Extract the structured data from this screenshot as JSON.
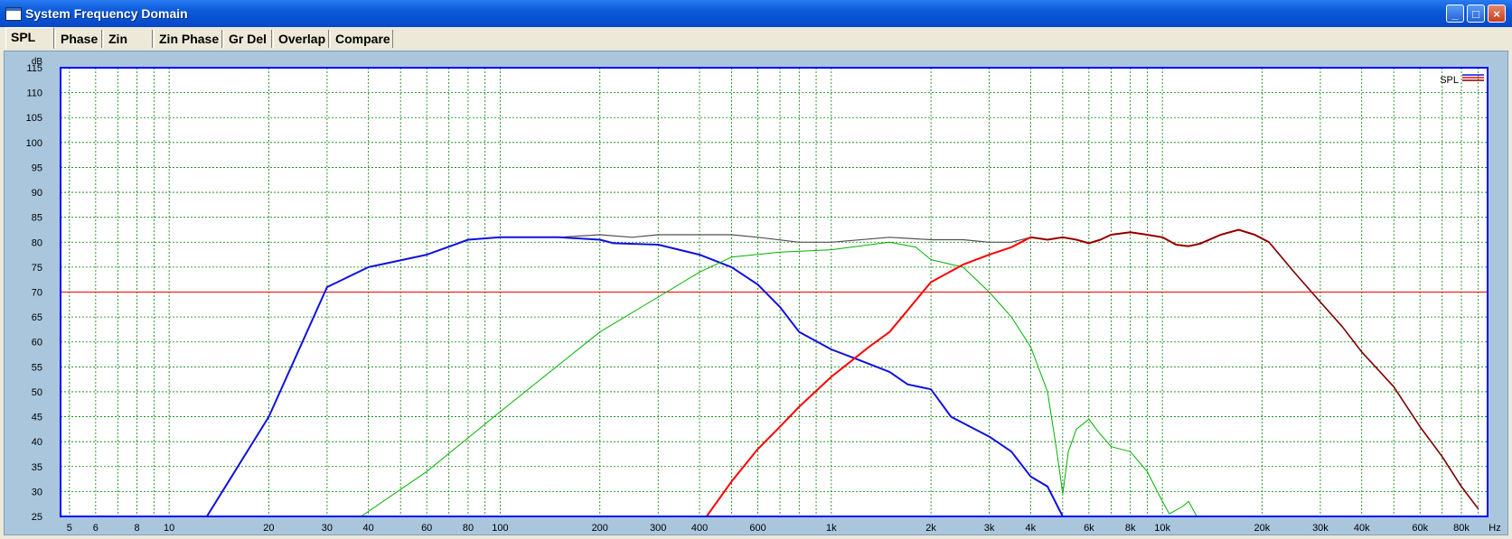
{
  "window": {
    "title": "System Frequency Domain"
  },
  "tabs": [
    {
      "label": "SPL",
      "active": true
    },
    {
      "label": "Phase"
    },
    {
      "label": "Zin"
    },
    {
      "label": "Zin Phase"
    },
    {
      "label": "Gr Del"
    },
    {
      "label": "Overlap"
    },
    {
      "label": "Compare"
    }
  ],
  "chart_data": {
    "type": "line",
    "x_scale": "log",
    "xlim": [
      4.7,
      96000
    ],
    "ylim": [
      25,
      115
    ],
    "ylabel": "dB",
    "xlabel": "Hz",
    "grid": true,
    "legend": {
      "label": "SPL",
      "position": "top-right"
    },
    "y_ticks": [
      25,
      30,
      35,
      40,
      45,
      50,
      55,
      60,
      65,
      70,
      75,
      80,
      85,
      90,
      95,
      100,
      105,
      110,
      115
    ],
    "x_tick_labels": [
      {
        "v": 5,
        "t": "5"
      },
      {
        "v": 6,
        "t": "6"
      },
      {
        "v": 8,
        "t": "8"
      },
      {
        "v": 10,
        "t": "10"
      },
      {
        "v": 20,
        "t": "20"
      },
      {
        "v": 30,
        "t": "30"
      },
      {
        "v": 40,
        "t": "40"
      },
      {
        "v": 60,
        "t": "60"
      },
      {
        "v": 80,
        "t": "80"
      },
      {
        "v": 100,
        "t": "100"
      },
      {
        "v": 200,
        "t": "200"
      },
      {
        "v": 300,
        "t": "300"
      },
      {
        "v": 400,
        "t": "400"
      },
      {
        "v": 600,
        "t": "600"
      },
      {
        "v": 1000,
        "t": "1k"
      },
      {
        "v": 2000,
        "t": "2k"
      },
      {
        "v": 3000,
        "t": "3k"
      },
      {
        "v": 4000,
        "t": "4k"
      },
      {
        "v": 6000,
        "t": "6k"
      },
      {
        "v": 8000,
        "t": "8k"
      },
      {
        "v": 10000,
        "t": "10k"
      },
      {
        "v": 20000,
        "t": "20k"
      },
      {
        "v": 30000,
        "t": "30k"
      },
      {
        "v": 40000,
        "t": "40k"
      },
      {
        "v": 60000,
        "t": "60k"
      },
      {
        "v": 80000,
        "t": "80k"
      }
    ],
    "reference_line": {
      "y": 70,
      "color": "#ff0000"
    },
    "colors": {
      "plot_bg": "#ffffff",
      "grid": "#008000",
      "axis_frame": "#0000ff",
      "outer_bg": "#a9c6dd"
    },
    "series": [
      {
        "color": "#505050",
        "width": 1.2,
        "points": [
          [
            13,
            25
          ],
          [
            20,
            45
          ],
          [
            30,
            71
          ],
          [
            40,
            75
          ],
          [
            60,
            77.5
          ],
          [
            80,
            80.5
          ],
          [
            100,
            81
          ],
          [
            150,
            81
          ],
          [
            200,
            81.5
          ],
          [
            250,
            81
          ],
          [
            300,
            81.5
          ],
          [
            500,
            81.5
          ],
          [
            600,
            81
          ],
          [
            800,
            80
          ],
          [
            1000,
            80
          ],
          [
            1500,
            81
          ],
          [
            2000,
            80.5
          ],
          [
            2500,
            80.5
          ],
          [
            3000,
            80
          ],
          [
            3500,
            80
          ],
          [
            4000,
            81
          ],
          [
            4500,
            80.5
          ],
          [
            5000,
            81
          ],
          [
            5500,
            80.5
          ],
          [
            6000,
            79.8
          ],
          [
            6500,
            80.5
          ],
          [
            7000,
            81.5
          ],
          [
            8000,
            82
          ],
          [
            9000,
            81.5
          ],
          [
            10000,
            81
          ],
          [
            11000,
            79.5
          ],
          [
            12000,
            79.2
          ],
          [
            13000,
            79.7
          ],
          [
            15000,
            81.5
          ],
          [
            17000,
            82.5
          ],
          [
            19000,
            81.5
          ],
          [
            21000,
            80
          ],
          [
            25000,
            74
          ],
          [
            30000,
            68
          ],
          [
            35000,
            63
          ],
          [
            40000,
            58
          ],
          [
            50000,
            51
          ],
          [
            60000,
            43
          ],
          [
            70000,
            37
          ],
          [
            80000,
            31
          ],
          [
            90000,
            26.5
          ]
        ]
      },
      {
        "color": "#1010e0",
        "width": 2,
        "points": [
          [
            13,
            25
          ],
          [
            20,
            45
          ],
          [
            30,
            71
          ],
          [
            40,
            75
          ],
          [
            60,
            77.5
          ],
          [
            80,
            80.5
          ],
          [
            100,
            81
          ],
          [
            150,
            81
          ],
          [
            200,
            80.5
          ],
          [
            220,
            79.8
          ],
          [
            300,
            79.5
          ],
          [
            400,
            77.5
          ],
          [
            500,
            75
          ],
          [
            600,
            71.5
          ],
          [
            700,
            67
          ],
          [
            800,
            62
          ],
          [
            1000,
            58.5
          ],
          [
            1200,
            56.5
          ],
          [
            1500,
            54
          ],
          [
            1700,
            51.5
          ],
          [
            2000,
            50.5
          ],
          [
            2300,
            45
          ],
          [
            3000,
            41
          ],
          [
            3500,
            38
          ],
          [
            4000,
            33
          ],
          [
            4500,
            31
          ],
          [
            5000,
            25
          ]
        ]
      },
      {
        "color": "#00b000",
        "width": 1,
        "points": [
          [
            38,
            25
          ],
          [
            60,
            34
          ],
          [
            100,
            46
          ],
          [
            200,
            62
          ],
          [
            300,
            69
          ],
          [
            400,
            74
          ],
          [
            500,
            77
          ],
          [
            700,
            78
          ],
          [
            1000,
            78.5
          ],
          [
            1500,
            80
          ],
          [
            1800,
            79
          ],
          [
            2000,
            76.5
          ],
          [
            2500,
            75
          ],
          [
            3000,
            70
          ],
          [
            3500,
            65
          ],
          [
            4000,
            59
          ],
          [
            4500,
            50
          ],
          [
            4800,
            38
          ],
          [
            5000,
            29.5
          ],
          [
            5200,
            38
          ],
          [
            5500,
            42.5
          ],
          [
            6000,
            44.5
          ],
          [
            6400,
            42
          ],
          [
            7000,
            39
          ],
          [
            8000,
            38
          ],
          [
            9000,
            34
          ],
          [
            10000,
            28
          ],
          [
            10500,
            25.5
          ],
          [
            11500,
            27
          ],
          [
            12000,
            28
          ],
          [
            12700,
            25
          ]
        ]
      },
      {
        "color": "#ff0000",
        "width": 2,
        "points": [
          [
            420,
            25
          ],
          [
            500,
            32
          ],
          [
            600,
            38.5
          ],
          [
            700,
            43
          ],
          [
            800,
            47
          ],
          [
            1000,
            53
          ],
          [
            1300,
            59
          ],
          [
            1500,
            62
          ],
          [
            2000,
            72
          ],
          [
            2500,
            75.5
          ],
          [
            3000,
            77.5
          ],
          [
            3500,
            79
          ],
          [
            4000,
            81
          ],
          [
            4500,
            80.5
          ],
          [
            5000,
            81
          ],
          [
            5500,
            80.5
          ],
          [
            6000,
            79.8
          ],
          [
            6500,
            80.5
          ],
          [
            7000,
            81.5
          ],
          [
            8000,
            82
          ],
          [
            9000,
            81.5
          ],
          [
            10000,
            81
          ],
          [
            11000,
            79.5
          ],
          [
            12000,
            79.2
          ],
          [
            13000,
            79.7
          ],
          [
            15000,
            81.5
          ],
          [
            17000,
            82.5
          ],
          [
            19000,
            81.5
          ],
          [
            21000,
            80
          ]
        ]
      },
      {
        "color": "#800000",
        "width": 1.6,
        "points": [
          [
            4000,
            81
          ],
          [
            4500,
            80.5
          ],
          [
            5000,
            81
          ],
          [
            5500,
            80.5
          ],
          [
            6000,
            79.8
          ],
          [
            6500,
            80.5
          ],
          [
            7000,
            81.5
          ],
          [
            8000,
            82
          ],
          [
            9000,
            81.5
          ],
          [
            10000,
            81
          ],
          [
            11000,
            79.5
          ],
          [
            12000,
            79.2
          ],
          [
            13000,
            79.7
          ],
          [
            15000,
            81.5
          ],
          [
            17000,
            82.5
          ],
          [
            19000,
            81.5
          ],
          [
            21000,
            80
          ],
          [
            25000,
            74
          ],
          [
            30000,
            68
          ],
          [
            35000,
            63
          ],
          [
            40000,
            58
          ],
          [
            50000,
            51
          ],
          [
            60000,
            43
          ],
          [
            70000,
            37
          ],
          [
            80000,
            31
          ],
          [
            90000,
            26.5
          ]
        ]
      }
    ]
  }
}
